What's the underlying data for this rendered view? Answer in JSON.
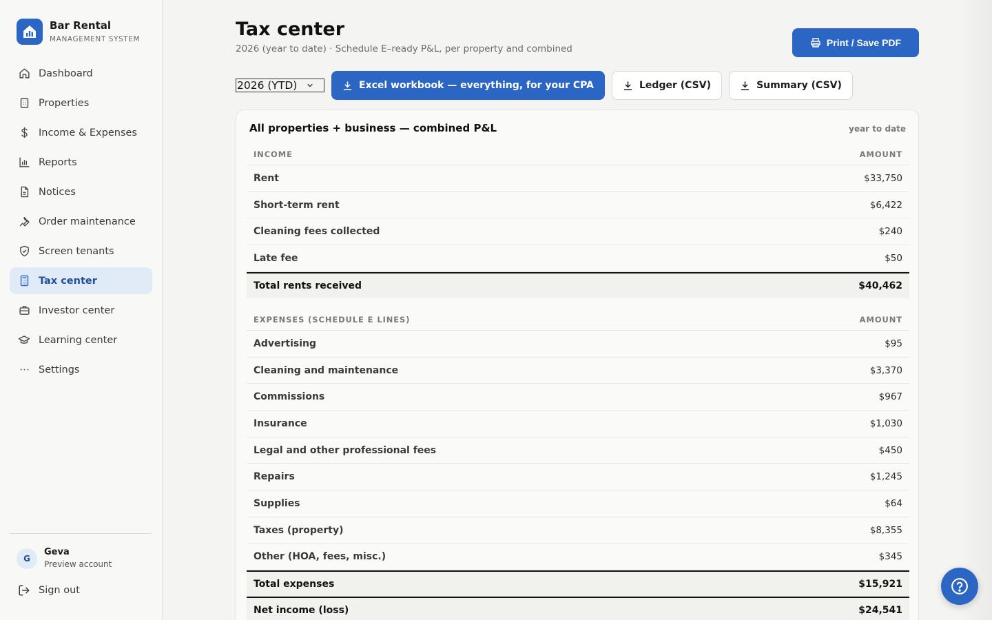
{
  "brand": {
    "name": "Bar Rental",
    "subtitle": "MANAGEMENT SYSTEM"
  },
  "sidebar": {
    "items": [
      {
        "label": "Dashboard",
        "icon": "home-icon"
      },
      {
        "label": "Properties",
        "icon": "building-icon"
      },
      {
        "label": "Income & Expenses",
        "icon": "dollar-icon"
      },
      {
        "label": "Reports",
        "icon": "bar-chart-icon"
      },
      {
        "label": "Notices",
        "icon": "document-icon"
      },
      {
        "label": "Order maintenance",
        "icon": "wrench-icon"
      },
      {
        "label": "Screen tenants",
        "icon": "shield-check-icon"
      },
      {
        "label": "Tax center",
        "icon": "calculator-icon",
        "active": true
      },
      {
        "label": "Investor center",
        "icon": "briefcase-icon"
      },
      {
        "label": "Learning center",
        "icon": "graduation-cap-icon"
      },
      {
        "label": "Settings",
        "icon": "more-dots-icon"
      }
    ]
  },
  "user": {
    "initial": "G",
    "name": "Geva",
    "role": "Preview account"
  },
  "signout": {
    "label": "Sign out"
  },
  "header": {
    "title": "Tax center",
    "subtitle": "2026 (year to date) · Schedule E–ready P&L, per property and combined",
    "print_label": "Print / Save PDF"
  },
  "toolbar": {
    "year_value": "2026 (YTD)",
    "excel_label": "Excel workbook — everything, for your CPA",
    "ledger_label": "Ledger (CSV)",
    "summary_label": "Summary (CSV)"
  },
  "card": {
    "title": "All properties + business — combined P&L",
    "meta": "year to date",
    "income": {
      "header_label": "INCOME",
      "header_amount": "AMOUNT",
      "rows": [
        {
          "label": "Rent",
          "amount": "$33,750"
        },
        {
          "label": "Short-term rent",
          "amount": "$6,422"
        },
        {
          "label": "Cleaning fees collected",
          "amount": "$240"
        },
        {
          "label": "Late fee",
          "amount": "$50"
        }
      ],
      "total_label": "Total rents received",
      "total_amount": "$40,462"
    },
    "expenses": {
      "header_label": "EXPENSES (SCHEDULE E LINES)",
      "header_amount": "AMOUNT",
      "rows": [
        {
          "label": "Advertising",
          "amount": "$95"
        },
        {
          "label": "Cleaning and maintenance",
          "amount": "$3,370"
        },
        {
          "label": "Commissions",
          "amount": "$967"
        },
        {
          "label": "Insurance",
          "amount": "$1,030"
        },
        {
          "label": "Legal and other professional fees",
          "amount": "$450"
        },
        {
          "label": "Repairs",
          "amount": "$1,245"
        },
        {
          "label": "Supplies",
          "amount": "$64"
        },
        {
          "label": "Taxes (property)",
          "amount": "$8,355"
        },
        {
          "label": "Other (HOA, fees, misc.)",
          "amount": "$345"
        }
      ],
      "total_label": "Total expenses",
      "total_amount": "$15,921"
    },
    "net_label": "Net income (loss)",
    "net_amount": "$24,541"
  },
  "help": {
    "icon": "help-circle-icon"
  },
  "colors": {
    "accent": "#2b66c4",
    "active_bg": "#e1ebf7",
    "page_bg": "#f4f4f2"
  }
}
